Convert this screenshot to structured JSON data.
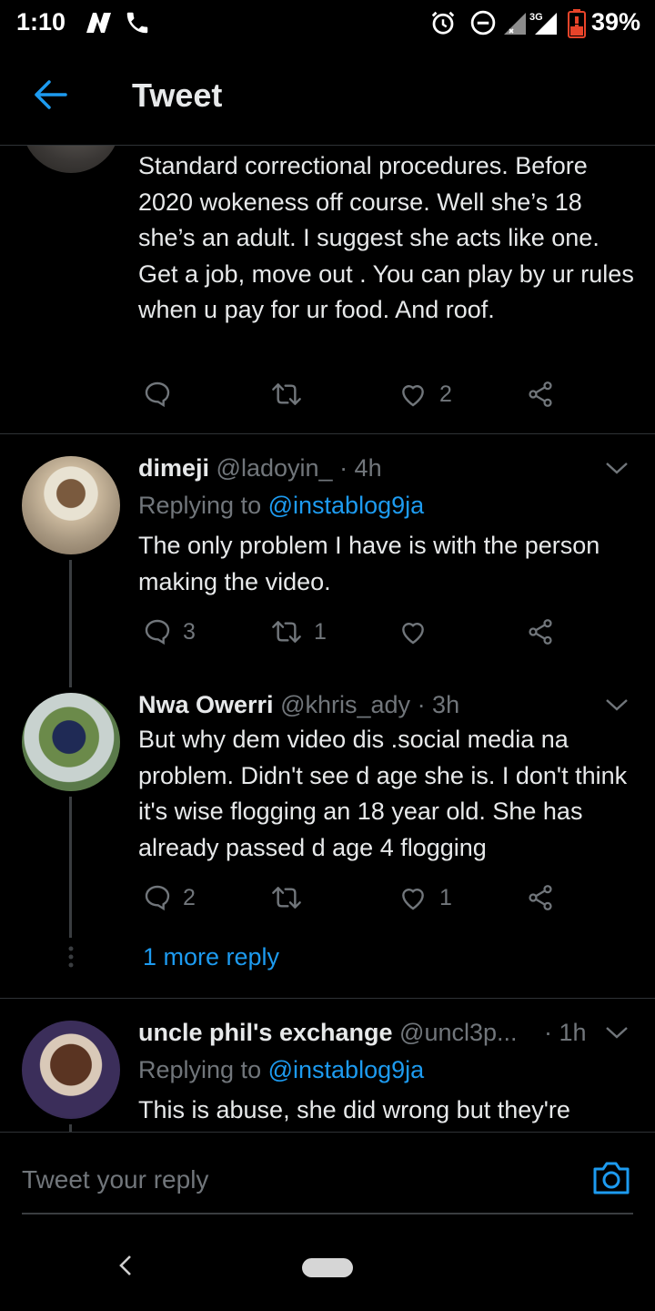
{
  "status_bar": {
    "time": "1:10",
    "network": "3G",
    "battery": "39%",
    "icons": [
      "n-notification-icon",
      "phone-icon",
      "alarm-icon",
      "dnd-icon",
      "signal-icon",
      "battery-icon"
    ]
  },
  "header": {
    "title": "Tweet",
    "back_icon": "arrow-left-icon"
  },
  "partial_tweet": {
    "text": "Standard correctional procedures. Before 2020 wokeness off course. Well she’s 18 she’s an adult. I suggest she acts like one. Get a job, move out . You can play by ur rules when u pay for ur food. And roof.",
    "replies": "",
    "retweets": "",
    "likes": "2"
  },
  "replies": [
    {
      "name": "dimeji",
      "handle": "@ladoyin_",
      "time": "· 4h",
      "replying_label": "Replying to",
      "replying_handle": "@instablog9ja",
      "text": "The only problem I have is with the person making the video.",
      "replies": "3",
      "retweets": "1",
      "likes": ""
    },
    {
      "name": "Nwa Owerri",
      "handle": "@khris_ady",
      "time": "· 3h",
      "text": "But why dem video dis .social media na problem.  Didn't see d age she is. I don't think it's wise flogging an 18 year old. She has already passed d age 4 flogging",
      "replies": "2",
      "retweets": "",
      "likes": "1",
      "more_reply": "1 more reply"
    },
    {
      "name": "uncle phil's exchange",
      "handle": "@uncl3p...",
      "time": "· 1h",
      "replying_label": "Replying to",
      "replying_handle": "@instablog9ja",
      "text": "This is abuse, she did wrong but they're"
    }
  ],
  "reply_bar": {
    "placeholder": "Tweet your reply",
    "camera_icon": "camera-icon"
  },
  "colors": {
    "accent": "#1d9bf0",
    "muted": "#71767b",
    "background": "#000000",
    "text": "#e7e9ea"
  }
}
